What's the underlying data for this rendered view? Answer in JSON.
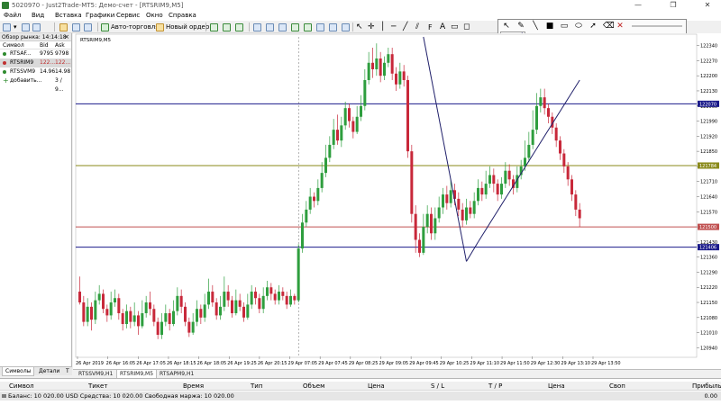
{
  "window": {
    "title": "5020970 - Just2Trade-MT5: Демо-счет - [RTSRIM9,M5]",
    "minimize": "—",
    "maximize": "❐",
    "close": "✕"
  },
  "menu": [
    "Файл",
    "Вид",
    "Вставка",
    "Графики",
    "Сервис",
    "Окно",
    "Справка"
  ],
  "toolbar": {
    "algo_trading": "Авто-торговля",
    "new_order": "Новый ордер"
  },
  "drawing_panel": {
    "colors": [
      "#ffffff",
      "#000000",
      "#ff0000",
      "#808080",
      "#c00000",
      "#008000",
      "#00a000",
      "#800080",
      "#404040",
      "#8000ff",
      "#0000a0",
      "#404080",
      "#ff00ff",
      "#00ffff",
      "#2a2a8a",
      "#ff8000"
    ]
  },
  "market_watch": {
    "header": "Обзор рынка: 14:14:18",
    "col_symbol": "Символ",
    "col_bid": "Bid",
    "col_ask": "Ask",
    "rows": [
      {
        "symbol": "RTSAF...",
        "bid": "9795",
        "ask": "9798",
        "color": "#2e8b2e"
      },
      {
        "symbol": "RTSRIM9",
        "bid": "122...",
        "ask": "122...",
        "color": "#c03030",
        "bid_color": "#c03030"
      },
      {
        "symbol": "RTSSVM9",
        "bid": "14.96",
        "ask": "14.98",
        "color": "#2e8b2e"
      },
      {
        "symbol": "добавить...",
        "bid": "",
        "ask": "3 / 9...",
        "color": "#2e8b2e"
      }
    ],
    "tab_symbols": "Символы",
    "tab_details": "Детали",
    "tab_more": "Т"
  },
  "chart_tabs": [
    "RTSSVM9,H1",
    "RTSRIM9,M5",
    "RTSAPM9,H1"
  ],
  "chart_data": {
    "type": "candlestick",
    "symbol_label": "RTSRIM9,M5",
    "y_ticks": [
      122340,
      122270,
      122200,
      122130,
      122060,
      121990,
      121920,
      121850,
      121780,
      121710,
      121640,
      121570,
      121500,
      121430,
      121360,
      121290,
      121220,
      121150,
      121080,
      121010,
      120940
    ],
    "x_ticks": [
      "26 Apr 2019",
      "26 Apr 16:05",
      "26 Apr 17:05",
      "26 Apr 18:15",
      "26 Apr 18:05",
      "26 Apr 19:25",
      "26 Apr 20:15",
      "29 Apr 07:05",
      "29 Apr 07:45",
      "29 Apr 08:25",
      "29 Apr 09:05",
      "29 Apr 09:45",
      "29 Apr 10:25",
      "29 Apr 11:10",
      "29 Apr 11:50",
      "29 Apr 12:30",
      "29 Apr 13:10",
      "29 Apr 13:50"
    ],
    "horizontal_lines": [
      {
        "value": 122070,
        "color": "#1a1a8a",
        "label": "122070"
      },
      {
        "value": 121784,
        "color": "#8a8a1a",
        "label": "121784"
      },
      {
        "value": 121500,
        "color": "#c05050",
        "label": "121500"
      },
      {
        "value": 121406,
        "color": "#1a1a8a",
        "label": "121406"
      }
    ],
    "price_label": {
      "value": 121500,
      "label": "121500"
    },
    "candles": [
      [
        121200,
        121150,
        121270,
        121140
      ],
      [
        121150,
        121060,
        121180,
        121040
      ],
      [
        121060,
        121130,
        121170,
        121040
      ],
      [
        121130,
        121070,
        121150,
        121020
      ],
      [
        121070,
        121160,
        121200,
        121050
      ],
      [
        121160,
        121190,
        121230,
        121140
      ],
      [
        121190,
        121120,
        121210,
        121100
      ],
      [
        121120,
        121090,
        121140,
        121060
      ],
      [
        121090,
        121150,
        121200,
        121070
      ],
      [
        121150,
        121170,
        121210,
        121130
      ],
      [
        121170,
        121100,
        121190,
        121070
      ],
      [
        121100,
        121050,
        121120,
        121020
      ],
      [
        121050,
        121110,
        121140,
        121030
      ],
      [
        121110,
        121060,
        121130,
        121030
      ],
      [
        121060,
        121090,
        121150,
        121040
      ],
      [
        121090,
        121040,
        121110,
        121000
      ],
      [
        121040,
        121100,
        121160,
        121030
      ],
      [
        121100,
        121150,
        121180,
        121080
      ],
      [
        121150,
        121120,
        121200,
        121090
      ],
      [
        121120,
        121060,
        121140,
        121040
      ],
      [
        121060,
        121000,
        121080,
        120980
      ],
      [
        121000,
        121060,
        121100,
        120980
      ],
      [
        121060,
        121100,
        121140,
        121040
      ],
      [
        121100,
        121050,
        121120,
        121020
      ],
      [
        121050,
        121110,
        121160,
        121040
      ],
      [
        121110,
        121180,
        121220,
        121090
      ],
      [
        121180,
        121130,
        121210,
        121100
      ],
      [
        121130,
        121060,
        121150,
        121040
      ],
      [
        121060,
        121010,
        121080,
        120990
      ],
      [
        121010,
        121060,
        121100,
        121000
      ],
      [
        121060,
        121120,
        121160,
        121040
      ],
      [
        121120,
        121080,
        121140,
        121050
      ],
      [
        121080,
        121140,
        121190,
        121060
      ],
      [
        121140,
        121200,
        121260,
        121120
      ],
      [
        121200,
        121150,
        121230,
        121130
      ],
      [
        121150,
        121090,
        121170,
        121070
      ],
      [
        121090,
        121130,
        121180,
        121070
      ],
      [
        121130,
        121200,
        121270,
        121110
      ],
      [
        121200,
        121160,
        121230,
        121130
      ],
      [
        121160,
        121100,
        121180,
        121080
      ],
      [
        121100,
        121160,
        121210,
        121090
      ],
      [
        121160,
        121130,
        121190,
        121110
      ],
      [
        121130,
        121080,
        121150,
        121060
      ],
      [
        121080,
        121140,
        121190,
        121070
      ],
      [
        121140,
        121200,
        121230,
        121120
      ],
      [
        121200,
        121170,
        121220,
        121140
      ],
      [
        121170,
        121120,
        121190,
        121100
      ],
      [
        121120,
        121180,
        121220,
        121100
      ],
      [
        121180,
        121220,
        121250,
        121160
      ],
      [
        121220,
        121190,
        121240,
        121160
      ],
      [
        121190,
        121160,
        121210,
        121140
      ],
      [
        121160,
        121200,
        121230,
        121140
      ],
      [
        121200,
        121180,
        121220,
        121160
      ],
      [
        121180,
        121140,
        121200,
        121120
      ],
      [
        121140,
        121180,
        121210,
        121130
      ],
      [
        121180,
        121160,
        121190,
        121140
      ],
      [
        121160,
        121400,
        121420,
        121150
      ],
      [
        121400,
        121520,
        121560,
        121380
      ],
      [
        121520,
        121580,
        121620,
        121500
      ],
      [
        121580,
        121640,
        121680,
        121560
      ],
      [
        121640,
        121620,
        121660,
        121590
      ],
      [
        121620,
        121680,
        121720,
        121600
      ],
      [
        121680,
        121750,
        121800,
        121660
      ],
      [
        121750,
        121820,
        121880,
        121730
      ],
      [
        121820,
        121880,
        121920,
        121800
      ],
      [
        121880,
        121950,
        122000,
        121860
      ],
      [
        121950,
        121900,
        122020,
        121880
      ],
      [
        121900,
        121970,
        122010,
        121870
      ],
      [
        121970,
        122050,
        122080,
        121950
      ],
      [
        122050,
        121990,
        122070,
        121960
      ],
      [
        121990,
        121940,
        122010,
        121910
      ],
      [
        121940,
        122010,
        122060,
        121930
      ],
      [
        122010,
        122060,
        122110,
        121990
      ],
      [
        122060,
        122180,
        122230,
        122040
      ],
      [
        122180,
        122260,
        122310,
        122160
      ],
      [
        122260,
        122230,
        122330,
        122190
      ],
      [
        122230,
        122280,
        122350,
        122200
      ],
      [
        122280,
        122200,
        122310,
        122170
      ],
      [
        122200,
        122260,
        122290,
        122180
      ],
      [
        122260,
        122300,
        122330,
        122240
      ],
      [
        122300,
        122210,
        122330,
        122180
      ],
      [
        122210,
        122160,
        122240,
        122130
      ],
      [
        122160,
        122220,
        122260,
        122140
      ],
      [
        122220,
        122180,
        122250,
        122150
      ],
      [
        122180,
        121850,
        122200,
        121820
      ],
      [
        121850,
        121560,
        121880,
        121520
      ],
      [
        121560,
        121440,
        121600,
        121380
      ],
      [
        121440,
        121380,
        121470,
        121360
      ],
      [
        121380,
        121500,
        121560,
        121370
      ],
      [
        121500,
        121560,
        121600,
        121470
      ],
      [
        121560,
        121470,
        121590,
        121440
      ],
      [
        121470,
        121540,
        121590,
        121440
      ],
      [
        121540,
        121590,
        121640,
        121520
      ],
      [
        121590,
        121650,
        121680,
        121560
      ],
      [
        121650,
        121610,
        121690,
        121580
      ],
      [
        121610,
        121670,
        121720,
        121590
      ],
      [
        121670,
        121630,
        121700,
        121600
      ],
      [
        121630,
        121580,
        121660,
        121550
      ],
      [
        121580,
        121530,
        121610,
        121500
      ],
      [
        121530,
        121590,
        121630,
        121510
      ],
      [
        121590,
        121560,
        121620,
        121540
      ],
      [
        121560,
        121620,
        121660,
        121540
      ],
      [
        121620,
        121680,
        121720,
        121600
      ],
      [
        121680,
        121650,
        121710,
        121620
      ],
      [
        121650,
        121700,
        121760,
        121630
      ],
      [
        121700,
        121740,
        121780,
        121680
      ],
      [
        121740,
        121700,
        121770,
        121660
      ],
      [
        121700,
        121650,
        121720,
        121620
      ],
      [
        121650,
        121700,
        121730,
        121630
      ],
      [
        121700,
        121760,
        121800,
        121680
      ],
      [
        121760,
        121720,
        121790,
        121690
      ],
      [
        121720,
        121680,
        121740,
        121650
      ],
      [
        121680,
        121740,
        121780,
        121660
      ],
      [
        121740,
        121780,
        121810,
        121720
      ],
      [
        121780,
        121820,
        121900,
        121760
      ],
      [
        121820,
        121880,
        121940,
        121800
      ],
      [
        121880,
        121950,
        122040,
        121860
      ],
      [
        121950,
        122060,
        122120,
        121930
      ],
      [
        122060,
        122100,
        122140,
        122030
      ],
      [
        122100,
        122050,
        122140,
        122020
      ],
      [
        122050,
        122010,
        122070,
        121980
      ],
      [
        122010,
        121960,
        122030,
        121930
      ],
      [
        121960,
        121900,
        121980,
        121870
      ],
      [
        121900,
        121840,
        121920,
        121810
      ],
      [
        121840,
        121780,
        121860,
        121750
      ],
      [
        121780,
        121720,
        121800,
        121690
      ],
      [
        121720,
        121650,
        121740,
        121620
      ],
      [
        121650,
        121580,
        121670,
        121550
      ],
      [
        121580,
        121540,
        121610,
        121500
      ]
    ],
    "trend_lines": [
      {
        "from": [
          88,
          122380
        ],
        "to": [
          99,
          121340
        ],
        "color": "#20206a"
      },
      {
        "from": [
          99,
          121340
        ],
        "to": [
          102,
          121430
        ],
        "color": "#20206a"
      },
      {
        "from": [
          102,
          121430
        ],
        "to": [
          128,
          122180
        ],
        "color": "#20206a"
      }
    ],
    "vertical_separator_index": 56
  },
  "terminal": {
    "headers": [
      "Символ",
      "Тикет",
      "Время",
      "Тип",
      "Объем",
      "Цена",
      "S / L",
      "T / P",
      "Цена",
      "Своп",
      "Прибыль"
    ],
    "balance_text": "Баланс: 10 020.00 USD  Средства: 10 020.00  Свободная маржа: 10 020.00",
    "profit": "0.00"
  }
}
